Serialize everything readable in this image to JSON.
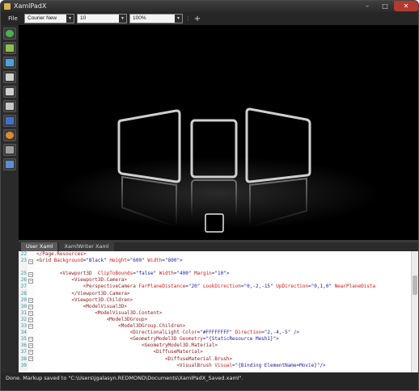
{
  "window": {
    "title": "XamlPadX",
    "minimize": "–",
    "maximize": "□",
    "close": "✕"
  },
  "toolbar": {
    "file_menu": "File",
    "font_family": "Courier New",
    "font_size": "10",
    "zoom": "100%",
    "add_symbol": "+"
  },
  "leftbar": {
    "buttons": [
      {
        "icon": "globe-icon",
        "color": "#4caf50"
      },
      {
        "icon": "puzzle-icon",
        "color": "#8bc34a"
      },
      {
        "icon": "clipboard-icon",
        "color": "#4aa3df"
      },
      {
        "icon": "text-icon",
        "color": "#d0d0d0"
      },
      {
        "icon": "printer-icon",
        "color": "#d0d0d0"
      },
      {
        "icon": "document-icon",
        "color": "#c7c7c7"
      },
      {
        "icon": "book-icon",
        "color": "#3f6fd1"
      },
      {
        "icon": "camera-icon",
        "color": "#e08a2e"
      },
      {
        "icon": "settings-icon",
        "color": "#9e9e9e"
      },
      {
        "icon": "window-icon",
        "color": "#5b8ed6"
      }
    ]
  },
  "tabs": [
    "User Xaml",
    "XamlWriter Xaml"
  ],
  "editor": {
    "line_numbers": [
      "22",
      "23",
      "",
      "25",
      "26",
      "27",
      "28",
      "29",
      "30",
      "31",
      "32",
      "33",
      "34",
      "35",
      "36",
      "37",
      "38",
      "39"
    ],
    "lines": [
      [
        {
          "c": "t",
          "s": "</Page.Resources>"
        }
      ],
      [
        {
          "c": "t",
          "s": "<Grid "
        },
        {
          "c": "a",
          "s": "Background"
        },
        {
          "c": "p",
          "s": "=\""
        },
        {
          "c": "v",
          "s": "Black"
        },
        {
          "c": "p",
          "s": "\" "
        },
        {
          "c": "a",
          "s": "Height"
        },
        {
          "c": "p",
          "s": "=\""
        },
        {
          "c": "v",
          "s": "600"
        },
        {
          "c": "p",
          "s": "\" "
        },
        {
          "c": "a",
          "s": "Width"
        },
        {
          "c": "p",
          "s": "=\""
        },
        {
          "c": "v",
          "s": "800"
        },
        {
          "c": "p",
          "s": "\">"
        }
      ],
      [
        {
          "c": "t",
          "s": ""
        }
      ],
      [
        {
          "c": "t",
          "s": "        <Viewport3D  "
        },
        {
          "c": "a",
          "s": "ClipToBounds"
        },
        {
          "c": "p",
          "s": "=\""
        },
        {
          "c": "v",
          "s": "false"
        },
        {
          "c": "p",
          "s": "\" "
        },
        {
          "c": "a",
          "s": "Width"
        },
        {
          "c": "p",
          "s": "=\""
        },
        {
          "c": "v",
          "s": "400"
        },
        {
          "c": "p",
          "s": "\" "
        },
        {
          "c": "a",
          "s": "Margin"
        },
        {
          "c": "p",
          "s": "=\""
        },
        {
          "c": "v",
          "s": "10"
        },
        {
          "c": "p",
          "s": "\">"
        }
      ],
      [
        {
          "c": "t",
          "s": "            <Viewport3D.Camera>"
        }
      ],
      [
        {
          "c": "t",
          "s": "                <PerspectiveCamera "
        },
        {
          "c": "a",
          "s": "FarPlaneDistance"
        },
        {
          "c": "p",
          "s": "=\""
        },
        {
          "c": "v",
          "s": "20"
        },
        {
          "c": "p",
          "s": "\" "
        },
        {
          "c": "a",
          "s": "LookDirection"
        },
        {
          "c": "p",
          "s": "=\""
        },
        {
          "c": "v",
          "s": "0,-2,-15"
        },
        {
          "c": "p",
          "s": "\" "
        },
        {
          "c": "a",
          "s": "UpDirection"
        },
        {
          "c": "p",
          "s": "=\""
        },
        {
          "c": "v",
          "s": "0,1,0"
        },
        {
          "c": "p",
          "s": "\" "
        },
        {
          "c": "a",
          "s": "NearPlaneDista"
        }
      ],
      [
        {
          "c": "t",
          "s": "            </Viewport3D.Camera>"
        }
      ],
      [
        {
          "c": "t",
          "s": "            <Viewport3D.Children>"
        }
      ],
      [
        {
          "c": "t",
          "s": "                <ModelVisual3D>"
        }
      ],
      [
        {
          "c": "t",
          "s": "                    <ModelVisual3D.Content>"
        }
      ],
      [
        {
          "c": "t",
          "s": "                        <Model3DGroup>"
        }
      ],
      [
        {
          "c": "t",
          "s": "                            <Model3DGroup.Children>"
        }
      ],
      [
        {
          "c": "t",
          "s": "                                <DirectionalLight "
        },
        {
          "c": "a",
          "s": "Color"
        },
        {
          "c": "p",
          "s": "=\""
        },
        {
          "c": "v",
          "s": "#FFFFFFFF"
        },
        {
          "c": "p",
          "s": "\" "
        },
        {
          "c": "a",
          "s": "Direction"
        },
        {
          "c": "p",
          "s": "=\""
        },
        {
          "c": "v",
          "s": "2,-4,-5"
        },
        {
          "c": "p",
          "s": "\" />"
        }
      ],
      [
        {
          "c": "t",
          "s": "                                <GeometryModel3D "
        },
        {
          "c": "a",
          "s": "Geometry"
        },
        {
          "c": "p",
          "s": "=\""
        },
        {
          "c": "v",
          "s": "{StaticResource Mesh1}"
        },
        {
          "c": "p",
          "s": "\">"
        }
      ],
      [
        {
          "c": "t",
          "s": "                                    <GeometryModel3D.Material>"
        }
      ],
      [
        {
          "c": "t",
          "s": "                                        <DiffuseMaterial>"
        }
      ],
      [
        {
          "c": "t",
          "s": "                                            <DiffuseMaterial.Brush>"
        }
      ],
      [
        {
          "c": "t",
          "s": "                                                <VisualBrush "
        },
        {
          "c": "a",
          "s": "Visual"
        },
        {
          "c": "p",
          "s": "=\""
        },
        {
          "c": "v",
          "s": "{Binding ElementName=Movie}"
        },
        {
          "c": "p",
          "s": "\"/>"
        }
      ]
    ]
  },
  "status": {
    "text": "Done. Markup saved to \"C:\\Users\\jgalasyn.REDMOND\\Documents\\XamlPadX_Saved.xaml\"."
  },
  "colors": {
    "background": "#000000",
    "frame_stroke": "#cfcfcf",
    "tag": "#8b1a1a",
    "attribute": "#d01818",
    "value": "#1a1aa6"
  }
}
